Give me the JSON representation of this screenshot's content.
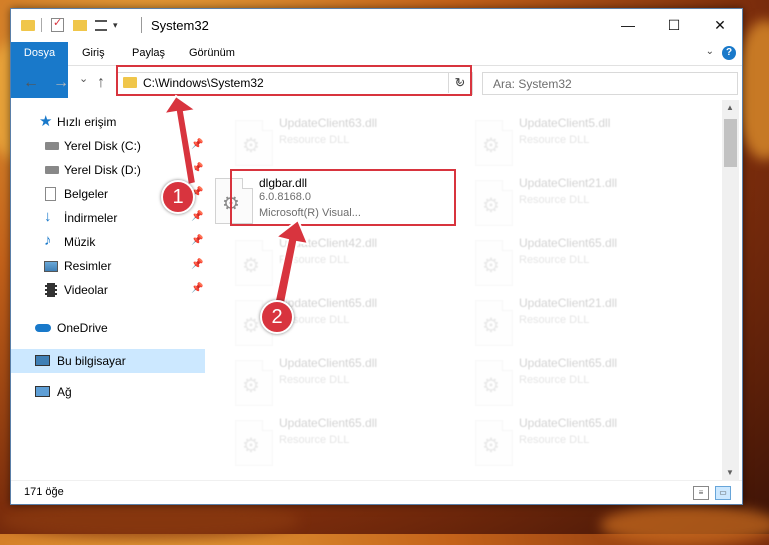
{
  "window": {
    "title": "System32"
  },
  "titlebar": {
    "minimize": "—",
    "maximize": "☐",
    "close": "✕"
  },
  "ribbon": {
    "tabs": [
      "Dosya",
      "Giriş",
      "Paylaş",
      "Görünüm"
    ],
    "help": "?"
  },
  "nav": {
    "back": "←",
    "forward": "→",
    "recent": "⌄",
    "up": "↑",
    "refresh": "↻"
  },
  "address": {
    "path": "C:\\Windows\\System32"
  },
  "search": {
    "placeholder": "Ara: System32"
  },
  "sidebar": {
    "items": [
      {
        "label": "Hızlı erişim"
      },
      {
        "label": "Yerel Disk (C:)"
      },
      {
        "label": "Yerel Disk (D:)"
      },
      {
        "label": "Belgeler"
      },
      {
        "label": "İndirmeler"
      },
      {
        "label": "Müzik"
      },
      {
        "label": "Resimler"
      },
      {
        "label": "Videolar"
      },
      {
        "label": "OneDrive"
      },
      {
        "label": "Bu bilgisayar"
      },
      {
        "label": "Ağ"
      }
    ]
  },
  "files": {
    "highlighted": {
      "name": "dlgbar.dll",
      "version": "6.0.8168.0",
      "company": "Microsoft(R) Visual..."
    },
    "faded": [
      {
        "name": "UpdateClient63.dll",
        "type": "Resource DLL"
      },
      {
        "name": "UpdateClient5.dll",
        "type": "Resource DLL"
      },
      {
        "name": "UpdateClient21.dll",
        "type": "Resource DLL"
      },
      {
        "name": "UpdateClient42.dll",
        "type": "Resource DLL"
      },
      {
        "name": "UpdateClient65.dll",
        "type": "Resource DLL"
      },
      {
        "name": "UpdateClient65.dll",
        "type": "Resource DLL"
      },
      {
        "name": "UpdateClient21.dll",
        "type": "Resource DLL"
      },
      {
        "name": "UpdateClient65.dll",
        "type": "Resource DLL"
      },
      {
        "name": "UpdateClient65.dll",
        "type": "Resource DLL"
      },
      {
        "name": "UpdateClient65.dll",
        "type": "Resource DLL"
      },
      {
        "name": "UpdateClient65.dll",
        "type": "Resource DLL"
      }
    ]
  },
  "status": {
    "count": "171 öğe"
  },
  "annotations": {
    "step1": "1",
    "step2": "2"
  },
  "colors": {
    "accent": "#1979ca",
    "highlight": "#d8343e",
    "selected": "#cce8ff"
  }
}
